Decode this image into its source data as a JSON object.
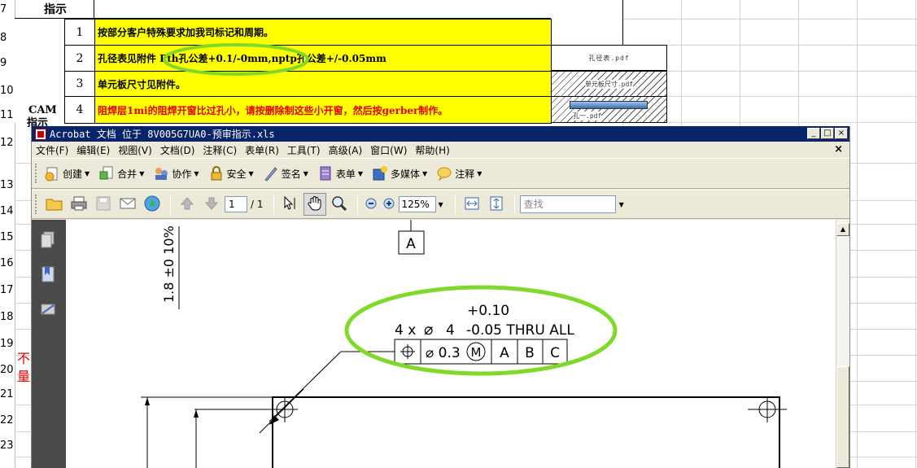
{
  "spreadsheet": {
    "row_numbers": [
      "7",
      "8",
      "9",
      "10",
      "11",
      "12",
      "13",
      "14",
      "15",
      "16",
      "17",
      "18",
      "19",
      "20",
      "21",
      "22",
      "23"
    ],
    "header_label": "指示",
    "cam_label": "CAM",
    "cam_label_2": "指示",
    "side_red_1": "不",
    "side_red_2": "量",
    "items": [
      {
        "num": "1",
        "text": "按部分客户特殊要求加我司标记和周期。"
      },
      {
        "num": "2",
        "text": "孔径表见附件 Pth孔公差+0.1/-0mm,nptp孔公差+/-0.05mm",
        "attachment": "孔径表.pdf"
      },
      {
        "num": "3",
        "text": "单元板尺寸见附件。",
        "attachment": "单元板尺寸.pdf"
      },
      {
        "num": "4",
        "text": "阻焊层1mi的阻焊开窗比过孔小，请按删除制这些小开窗，然后按gerber制作。",
        "attachment": "孔一.pdf"
      }
    ],
    "highlight_color": "#ffff00",
    "annotation_color": "#7fd92a"
  },
  "acrobat": {
    "title": "Acrobat 文档 位于 8V005G7UA0-预审指示.xls",
    "window_buttons": {
      "minimize": "_",
      "restore": "□",
      "close": "×"
    },
    "menu": [
      "文件(F)",
      "编辑(E)",
      "视图(V)",
      "文档(D)",
      "注释(C)",
      "表单(R)",
      "工具(T)",
      "高级(A)",
      "窗口(W)",
      "帮助(H)"
    ],
    "menu_close": "×",
    "toolbar1": [
      {
        "label": "创建",
        "icon": "create-icon"
      },
      {
        "label": "合并",
        "icon": "combine-icon"
      },
      {
        "label": "协作",
        "icon": "collaborate-icon"
      },
      {
        "label": "安全",
        "icon": "lock-icon"
      },
      {
        "label": "签名",
        "icon": "pen-icon"
      },
      {
        "label": "表单",
        "icon": "form-icon"
      },
      {
        "label": "多媒体",
        "icon": "multimedia-icon"
      },
      {
        "label": "注释",
        "icon": "comment-icon"
      }
    ],
    "toolbar2": {
      "current_page": "1",
      "total_pages": "/ 1",
      "zoom": "125%",
      "search_placeholder": "查找"
    },
    "drawing": {
      "datum_label": "A",
      "height_dim": "1.8 ±0 10%",
      "hole_count": "4 x",
      "diameter_symbol": "⌀",
      "diameter": "4",
      "tol_plus": "+0.10",
      "tol_minus": "-0.05 THRU ALL",
      "fcf_position": "⌖",
      "fcf_tolerance": "⌀ 0.3",
      "fcf_modifier": "M",
      "fcf_datum_a": "A",
      "fcf_datum_b": "B",
      "fcf_datum_c": "C"
    }
  }
}
